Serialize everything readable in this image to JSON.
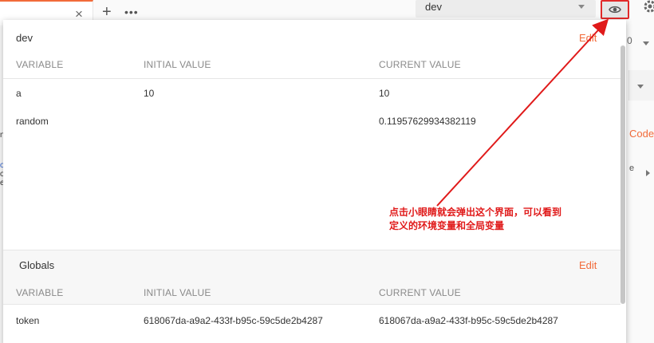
{
  "tabs": {
    "close_glyph": "×",
    "add_glyph": "+",
    "more_glyph": "•••"
  },
  "environment": {
    "selected": "dev"
  },
  "background": {
    "right_text_1": "0",
    "code_link": "Code",
    "right_text_2": "e",
    "left_fragments": [
      "n",
      "o",
      "o",
      "e"
    ]
  },
  "panel": {
    "env_section": {
      "title": "dev",
      "edit_label": "Edit",
      "columns": [
        "VARIABLE",
        "INITIAL VALUE",
        "CURRENT VALUE"
      ],
      "rows": [
        {
          "variable": "a",
          "initial": "10",
          "current": "10"
        },
        {
          "variable": "random",
          "initial": "",
          "current": "0.11957629934382119"
        }
      ]
    },
    "globals_section": {
      "title": "Globals",
      "edit_label": "Edit",
      "columns": [
        "VARIABLE",
        "INITIAL VALUE",
        "CURRENT VALUE"
      ],
      "rows": [
        {
          "variable": "token",
          "initial": "618067da-a9a2-433f-b95c-59c5de2b4287",
          "current": "618067da-a9a2-433f-b95c-59c5de2b4287"
        }
      ]
    }
  },
  "annotation": {
    "line1": "点击小眼睛就会弹出这个界面，可以看到",
    "line2": "定义的环境变量和全局变量",
    "color": "#e01a1a"
  },
  "colors": {
    "accent": "#f26b3a",
    "highlight_border": "#e12a2a"
  }
}
